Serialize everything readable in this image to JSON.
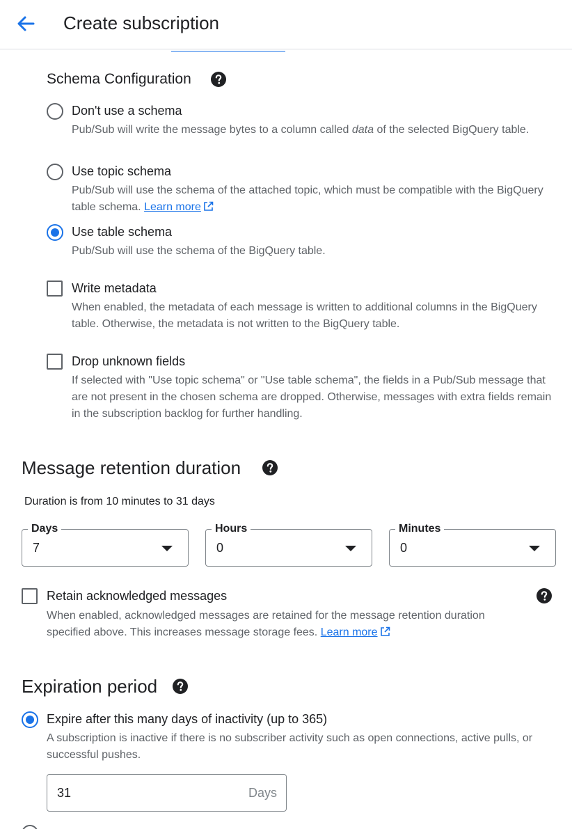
{
  "header": {
    "back_icon": "arrow-left-icon",
    "title": "Create subscription"
  },
  "schema": {
    "heading": "Schema Configuration",
    "options": [
      {
        "label": "Don't use a schema",
        "desc_before": "Pub/Sub will write the message bytes to a column called ",
        "desc_em": "data",
        "desc_after": " of the selected BigQuery table.",
        "checked": false
      },
      {
        "label": "Use topic schema",
        "desc": "Pub/Sub will use the schema of the attached topic, which must be compatible with the BigQuery table schema.",
        "link": "Learn more",
        "checked": false
      },
      {
        "label": "Use table schema",
        "desc": "Pub/Sub will use the schema of the BigQuery table.",
        "checked": true
      }
    ],
    "write_metadata": {
      "label": "Write metadata",
      "desc": "When enabled, the metadata of each message is written to additional columns in the BigQuery table. Otherwise, the metadata is not written to the BigQuery table.",
      "checked": false
    },
    "drop_unknown": {
      "label": "Drop unknown fields",
      "desc": "If selected with \"Use topic schema\" or \"Use table schema\", the fields in a Pub/Sub message that are not present in the chosen schema are dropped. Otherwise, messages with extra fields remain in the subscription backlog for further handling.",
      "checked": false
    }
  },
  "retention": {
    "heading": "Message retention duration",
    "subtext": "Duration is from 10 minutes to 31 days",
    "days": {
      "label": "Days",
      "value": "7"
    },
    "hours": {
      "label": "Hours",
      "value": "0"
    },
    "minutes": {
      "label": "Minutes",
      "value": "0"
    },
    "retain_acked": {
      "label": "Retain acknowledged messages",
      "desc": "When enabled, acknowledged messages are retained for the message retention duration specified above. This increases message storage fees.",
      "link": "Learn more",
      "checked": false
    }
  },
  "expiration": {
    "heading": "Expiration period",
    "option_label": "Expire after this many days of inactivity (up to 365)",
    "option_desc": "A subscription is inactive if there is no subscriber activity such as open connections, active pulls, or successful pushes.",
    "checked": true,
    "days_value": "31",
    "days_suffix": "Days"
  },
  "colors": {
    "accent": "#1a73e8",
    "text": "#202124",
    "secondary_text": "#5f6368",
    "border": "#80868b"
  }
}
